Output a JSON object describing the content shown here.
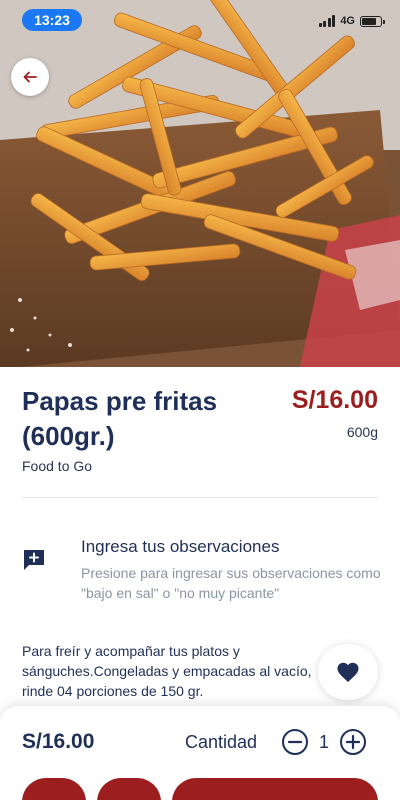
{
  "status_bar": {
    "time": "13:23",
    "network": "4G",
    "battery_level": 0.75
  },
  "header": {
    "back_icon": "arrow-left-icon"
  },
  "product": {
    "name": "Papas pre fritas (600gr.)",
    "brand": "Food to Go",
    "price": "S/16.00",
    "weight": "600g",
    "description": "Para freír y acompañar tus platos y sánguches.Congeladas y empacadas al vacío, rinde 04 porciones de 150 gr."
  },
  "observations": {
    "icon": "add-comment-icon",
    "title": "Ingresa tus observaciones",
    "hint": "Presione para ingresar sus observaciones como \"bajo en sal\" o \"no muy picante\""
  },
  "favorite": {
    "icon": "heart-icon"
  },
  "footer": {
    "total": "S/16.00",
    "quantity_label": "Cantidad",
    "quantity": "1",
    "minus_icon": "minus-circle-icon",
    "plus_icon": "plus-circle-icon"
  },
  "colors": {
    "primary": "#1f2f57",
    "accent": "#9c1e1e",
    "muted": "#8a95a5",
    "status_pill": "#1b78f2"
  }
}
